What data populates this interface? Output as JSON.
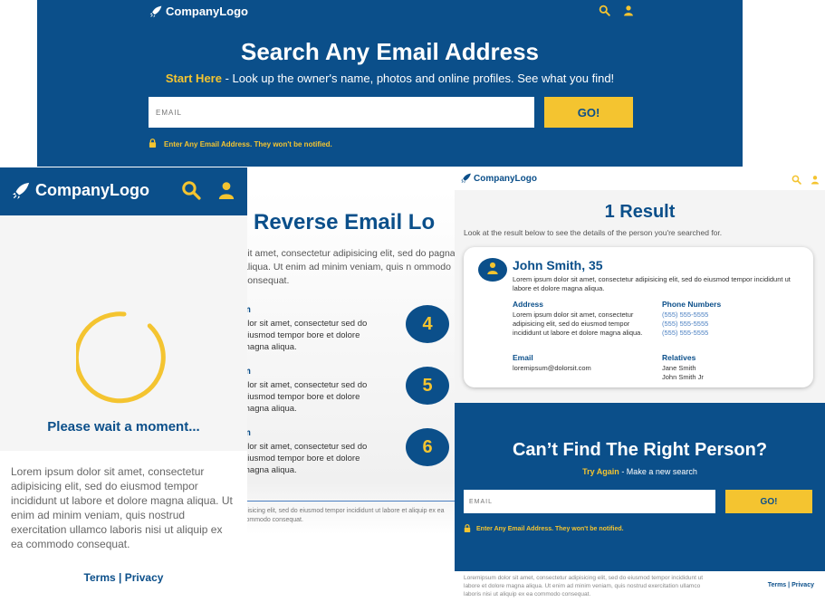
{
  "colors": {
    "navy": "#0b4f8a",
    "gold": "#f4c430",
    "link_blue": "#4a7fc1"
  },
  "icons": {
    "logo": "rocket-icon",
    "search": "search-icon",
    "user": "user-icon",
    "lock": "lock-icon"
  },
  "panel_a": {
    "logo_text": "CompanyLogo",
    "title": "Search Any Email Address",
    "sub_lead": "Start Here",
    "sub_rest": " - Look up the owner's name, photos and online profiles. See what you find!",
    "email_placeholder": "EMAIL",
    "go_label": "GO!",
    "notice": "Enter Any Email Address. They won't be notified."
  },
  "panel_b": {
    "logo_text": "CompanyLogo",
    "wait_text": "Please wait a moment...",
    "paragraph": "Lorem ipsum dolor sit amet, consectetur adipisicing elit, sed do eiusmod tempor incididunt ut labore et dolore magna aliqua. Ut enim ad minim veniam, quis nostrud exercitation ullamco laboris nisi ut aliquip ex ea commodo consequat.",
    "terms": "Terms",
    "sep": "|",
    "privacy": "Privacy"
  },
  "panel_c": {
    "title": "Reverse Email Lo",
    "paragraph": "sit amet, consectetur adipisicing elit, sed do pagna aliqua. Ut enim ad minim veniam, quis n ommodo consequat.",
    "steps": [
      {
        "head": "m",
        "text": "olor sit amet, consectetur sed do eiusmod tempor bore et dolore magna aliqua.",
        "num": "4"
      },
      {
        "head": "m",
        "text": "olor sit amet, consectetur sed do eiusmod tempor bore et dolore magna aliqua.",
        "num": "5"
      },
      {
        "head": "m",
        "text": "olor sit amet, consectetur sed do eiusmod tempor bore et dolore magna aliqua.",
        "num": "6"
      }
    ],
    "footer": "ipisicing elit, sed do eiusmod tempor incididunt ut labore et aliquip ex ea commodo consequat."
  },
  "panel_d": {
    "logo_text": "CompanyLogo",
    "title": "1 Result",
    "subtitle": "Look at the result below to see the details of the person you're searched for.",
    "card": {
      "name": "John Smith, 35",
      "desc": "Lorem ipsum dolor sit amet, consectetur adipisicing elit, sed do eiusmod tempor incididunt ut labore et dolore magna aliqua.",
      "address_label": "Address",
      "address": "Lorem ipsum dolor sit amet, consectetur adipisicing elit, sed do eiusmod tempor incididunt ut labore et dolore magna aliqua.",
      "phones_label": "Phone Numbers",
      "phones": [
        "(555) 555-5555",
        "(555) 555-5555",
        "(555) 555-5555"
      ],
      "email_label": "Email",
      "email": "loremipsum@dolorsit.com",
      "relatives_label": "Relatives",
      "relatives": [
        "Jane Smith",
        "John Smith Jr"
      ]
    },
    "cf_title": "Can’t Find The Right Person?",
    "cf_lead": "Try Again",
    "cf_rest": " - Make a new search",
    "email_placeholder": "EMAIL",
    "go_label": "GO!",
    "notice": "Enter Any Email Address. They won't be notified.",
    "footer": "Loremipsum dolor sit amet, consectetur adipisicing elit, sed do eiusmod tempor incididunt ut labore et dolore magna aliqua. Ut enim ad minim veniam, quis nostrud exercitation ullamco laboris nisi ut aliquip ex ea commodo consequat.",
    "terms": "Terms",
    "sep": "|",
    "privacy": "Privacy"
  }
}
